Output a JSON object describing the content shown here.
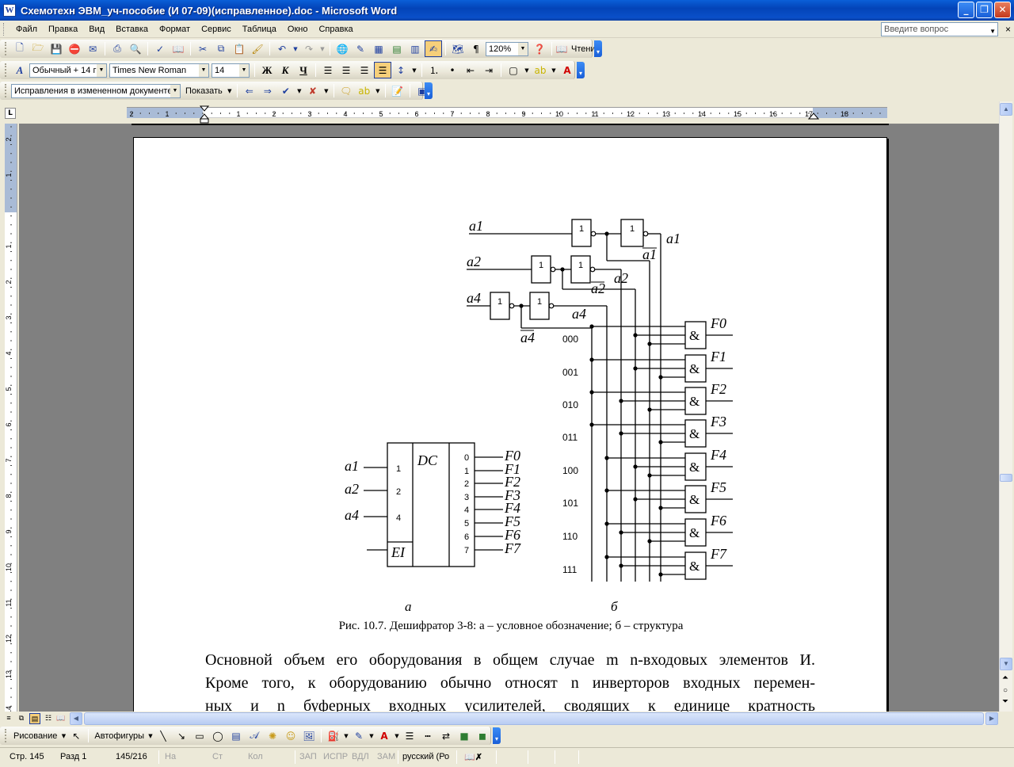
{
  "window": {
    "title": "Схемотехн ЭВМ_уч-пособие (И 07-09)(исправленное).doc - Microsoft Word",
    "app_icon": "W",
    "minimize": "_",
    "maximize": "❐",
    "close": "✕"
  },
  "menu": {
    "items": [
      "Файл",
      "Правка",
      "Вид",
      "Вставка",
      "Формат",
      "Сервис",
      "Таблица",
      "Окно",
      "Справка"
    ],
    "ask_placeholder": "Введите вопрос",
    "close_glyph": "×"
  },
  "standard_toolbar": {
    "zoom": "120%",
    "read_label": "Чтение"
  },
  "format_toolbar": {
    "style": "Обычный + 14 г",
    "font": "Times New Roman",
    "size": "14",
    "bold": "Ж",
    "italic": "К",
    "underline": "Ч"
  },
  "review_toolbar": {
    "mode": "Исправления в измененном документе",
    "show": "Показать"
  },
  "ruler": {
    "h_labels": [
      "2",
      "1",
      "1",
      "2",
      "3",
      "4",
      "5",
      "6",
      "7",
      "8",
      "9",
      "10",
      "11",
      "12",
      "13",
      "14",
      "15",
      "16",
      "17",
      "18"
    ],
    "v_labels": [
      "2",
      "1",
      "1",
      "2",
      "3",
      "4",
      "5",
      "6",
      "7",
      "8",
      "9",
      "10",
      "11",
      "12",
      "13",
      "14"
    ]
  },
  "figure": {
    "inputs_b": [
      "a1",
      "a2",
      "a4"
    ],
    "gate_label": "1",
    "and_label": "&",
    "outputs": [
      "F0",
      "F1",
      "F2",
      "F3",
      "F4",
      "F5",
      "F6",
      "F7"
    ],
    "codes": [
      "000",
      "001",
      "010",
      "011",
      "100",
      "101",
      "110",
      "111"
    ],
    "dc_inputs": [
      "a1",
      "a2",
      "a4"
    ],
    "dc_input_nums": [
      "1",
      "2",
      "4"
    ],
    "dc_title": "DC",
    "dc_enable": "EI",
    "dc_out_nums": [
      "0",
      "1",
      "2",
      "3",
      "4",
      "5",
      "6",
      "7"
    ],
    "wire_labels": [
      "a1",
      "a2",
      "a4"
    ],
    "inv_labels": [
      "a1",
      "a2",
      "a4"
    ],
    "sub_a": "а",
    "sub_b": "б",
    "caption": "Рис. 10.7. Дешифратор 3-8:  а – условное обозначение;  б – структура"
  },
  "body": {
    "lines": [
      "Основной объем его оборудования в общем случае m  n-входовых элементов И.",
      "Кроме того, к оборудованию обычно относят n инверторов входных перемен-",
      "ных и n буферных входных усилителей, сводящих к единице кратность"
    ]
  },
  "drawing_toolbar": {
    "draw": "Рисование",
    "autoshapes": "Автофигуры"
  },
  "status": {
    "page": "Стр. 145",
    "section": "Разд 1",
    "pages": "145/216",
    "at": "На",
    "line": "Ст",
    "col": "Кол",
    "rec": "ЗАП",
    "trk": "ИСПР",
    "ext": "ВДЛ",
    "ovr": "ЗАМ",
    "lang": "русский (Ро"
  }
}
